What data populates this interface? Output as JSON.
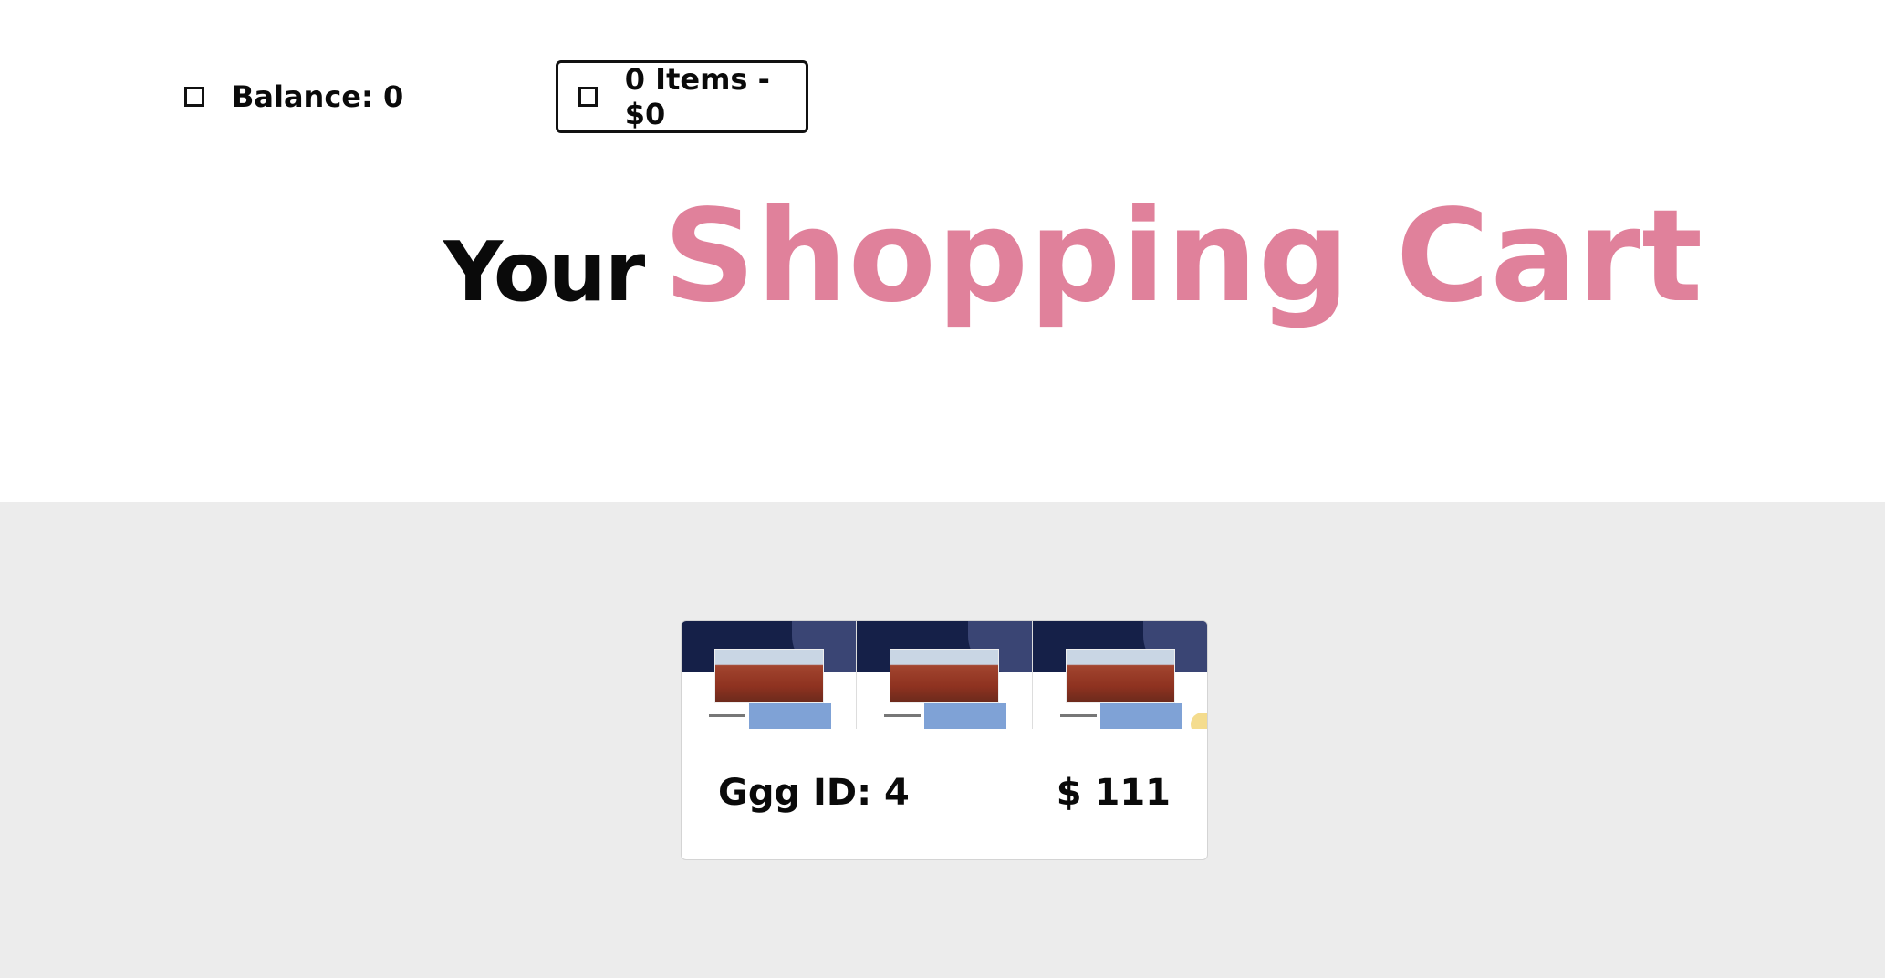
{
  "header": {
    "balance_label": "Balance: 0",
    "cart_summary_label": "0 Items - $0"
  },
  "title": {
    "prefix": "Your",
    "accent": "Shopping Cart",
    "accent_color": "#e0819b"
  },
  "cart": {
    "items": [
      {
        "name": "Ggg ID: 4",
        "price": "$ 111"
      }
    ]
  },
  "icons": {
    "balance_checkbox": "checkbox-icon",
    "cart_checkbox": "checkbox-icon"
  }
}
